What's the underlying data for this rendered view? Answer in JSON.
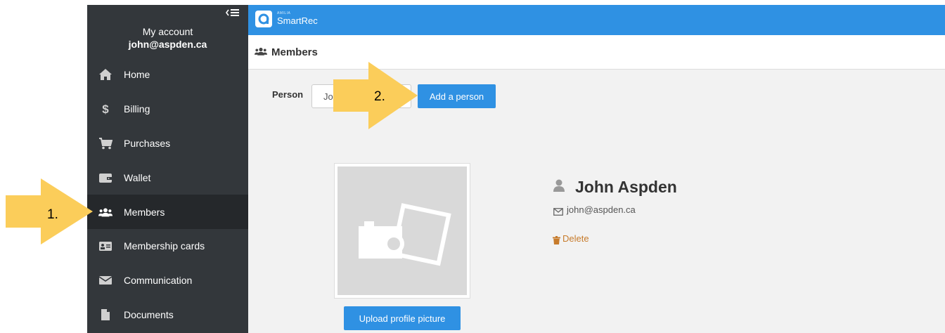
{
  "sidebar": {
    "account_title": "My account",
    "account_email": "john@aspden.ca",
    "items": [
      {
        "label": "Home",
        "icon": "home-icon"
      },
      {
        "label": "Billing",
        "icon": "dollar-icon"
      },
      {
        "label": "Purchases",
        "icon": "cart-icon"
      },
      {
        "label": "Wallet",
        "icon": "wallet-icon"
      },
      {
        "label": "Members",
        "icon": "users-icon",
        "active": true
      },
      {
        "label": "Membership cards",
        "icon": "id-card-icon"
      },
      {
        "label": "Communication",
        "icon": "envelope-icon"
      },
      {
        "label": "Documents",
        "icon": "file-icon"
      }
    ]
  },
  "topbar": {
    "logo_small": "AMILIA",
    "logo_text": "SmartRec",
    "color": "#2f91e3"
  },
  "header": {
    "title": "Members"
  },
  "search": {
    "label": "Person",
    "value": "Jo",
    "add_button": "Add a person"
  },
  "profile": {
    "name": "John Aspden",
    "email": "john@aspden.ca",
    "delete_label": "Delete",
    "upload_button": "Upload profile picture"
  },
  "annotations": {
    "step1": "1.",
    "step2": "2.",
    "arrow_color": "#fbcd5a"
  }
}
